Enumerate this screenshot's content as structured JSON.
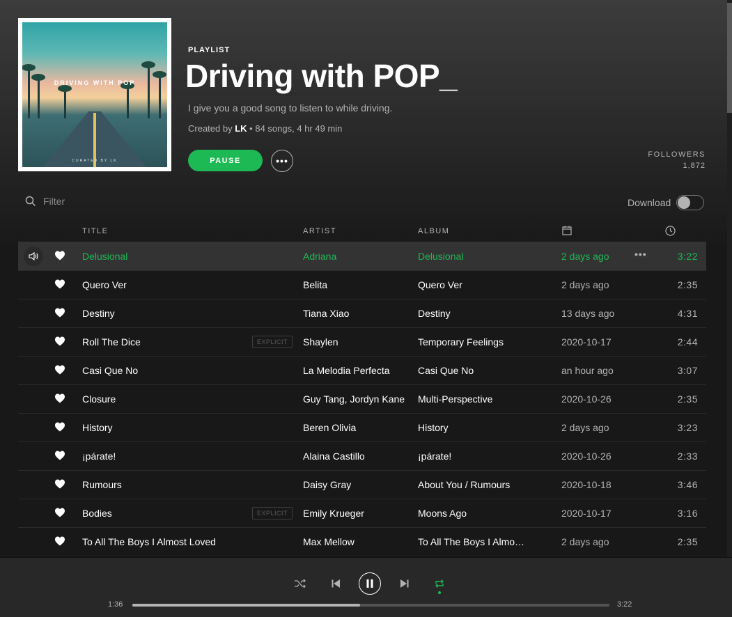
{
  "playlist": {
    "kind": "PLAYLIST",
    "title": "Driving with POP_",
    "description": "I give you a good song to listen to while driving.",
    "created_by_prefix": "Created by",
    "owner": "LK",
    "stats": " • 84 songs, 4 hr 49 min",
    "cover_text": "DRIVING WITH POP",
    "cover_subtext": "CURATED BY LK"
  },
  "actions": {
    "pause_label": "PAUSE",
    "more_label": "•••"
  },
  "followers": {
    "label": "FOLLOWERS",
    "count": "1,872"
  },
  "filter": {
    "placeholder": "Filter"
  },
  "download": {
    "label": "Download",
    "enabled": false
  },
  "columns": {
    "title": "TITLE",
    "artist": "ARTIST",
    "album": "ALBUM",
    "added_icon": "calendar-icon",
    "duration_icon": "clock-icon"
  },
  "tracks": [
    {
      "title": "Delusional",
      "artist": "Adriana",
      "album": "Delusional",
      "added": "2 days ago",
      "duration": "3:22",
      "explicit": false,
      "playing": true
    },
    {
      "title": "Quero Ver",
      "artist": "Belita",
      "album": "Quero Ver",
      "added": "2 days ago",
      "duration": "2:35",
      "explicit": false
    },
    {
      "title": "Destiny",
      "artist": "Tiana Xiao",
      "album": "Destiny",
      "added": "13 days ago",
      "duration": "4:31",
      "explicit": false
    },
    {
      "title": "Roll The Dice",
      "artist": "Shaylen",
      "album": "Temporary Feelings",
      "added": "2020-10-17",
      "duration": "2:44",
      "explicit": true
    },
    {
      "title": "Casi Que No",
      "artist": "La Melodia Perfecta",
      "album": "Casi Que No",
      "added": "an hour ago",
      "duration": "3:07",
      "explicit": false
    },
    {
      "title": "Closure",
      "artist": "Guy Tang, Jordyn Kane",
      "album": "Multi-Perspective",
      "added": "2020-10-26",
      "duration": "2:35",
      "explicit": false
    },
    {
      "title": "History",
      "artist": "Beren Olivia",
      "album": "History",
      "added": "2 days ago",
      "duration": "3:23",
      "explicit": false
    },
    {
      "title": "¡párate!",
      "artist": "Alaina Castillo",
      "album": "¡párate!",
      "added": "2020-10-26",
      "duration": "2:33",
      "explicit": false
    },
    {
      "title": "Rumours",
      "artist": "Daisy Gray",
      "album": "About You / Rumours",
      "added": "2020-10-18",
      "duration": "3:46",
      "explicit": false
    },
    {
      "title": "Bodies",
      "artist": "Emily Krueger",
      "album": "Moons Ago",
      "added": "2020-10-17",
      "duration": "3:16",
      "explicit": true
    },
    {
      "title": "To All The Boys I Almost Loved",
      "artist": "Max Mellow",
      "album": "To All The Boys I Almost Loved",
      "added": "2 days ago",
      "duration": "2:35",
      "explicit": false
    }
  ],
  "explicit_label": "EXPLICIT",
  "row_more_label": "•••",
  "player": {
    "elapsed": "1:36",
    "total": "3:22",
    "progress_fraction": 0.477,
    "shuffle": false,
    "repeat": true,
    "accent": "#1db954"
  }
}
